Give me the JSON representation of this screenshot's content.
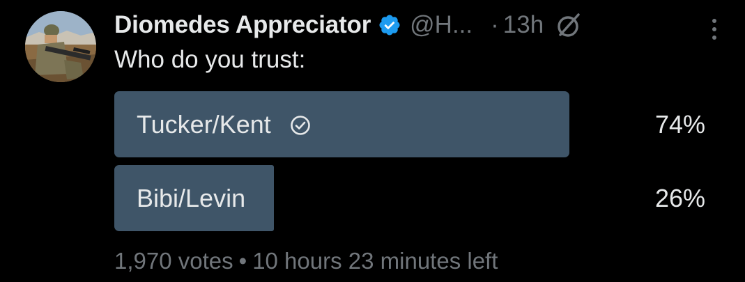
{
  "author": {
    "display_name": "Diomedes Appreciator",
    "handle": "@H...",
    "time_separator": "·",
    "time_ago": "13h",
    "verified": true,
    "avatar_icon": "soldier-avatar"
  },
  "tweet": {
    "text": "Who do you trust:"
  },
  "poll": {
    "options": [
      {
        "label": "Tucker/Kent",
        "percent": "74%",
        "share": 0.74,
        "selected": true
      },
      {
        "label": "Bibi/Levin",
        "percent": "26%",
        "share": 0.26,
        "selected": false
      }
    ],
    "votes": "1,970 votes",
    "separator": "•",
    "time_left": "10 hours 23 minutes left"
  },
  "colors": {
    "background": "#000000",
    "text": "#e7e9ea",
    "muted": "#71767b",
    "poll_bar": "#3f5568",
    "verified_badge": "#1d9bf0"
  },
  "icons": {
    "verified": "verified-badge-icon",
    "grok": "grok-icon",
    "more": "more-vertical-icon",
    "selected": "check-circle-icon"
  }
}
